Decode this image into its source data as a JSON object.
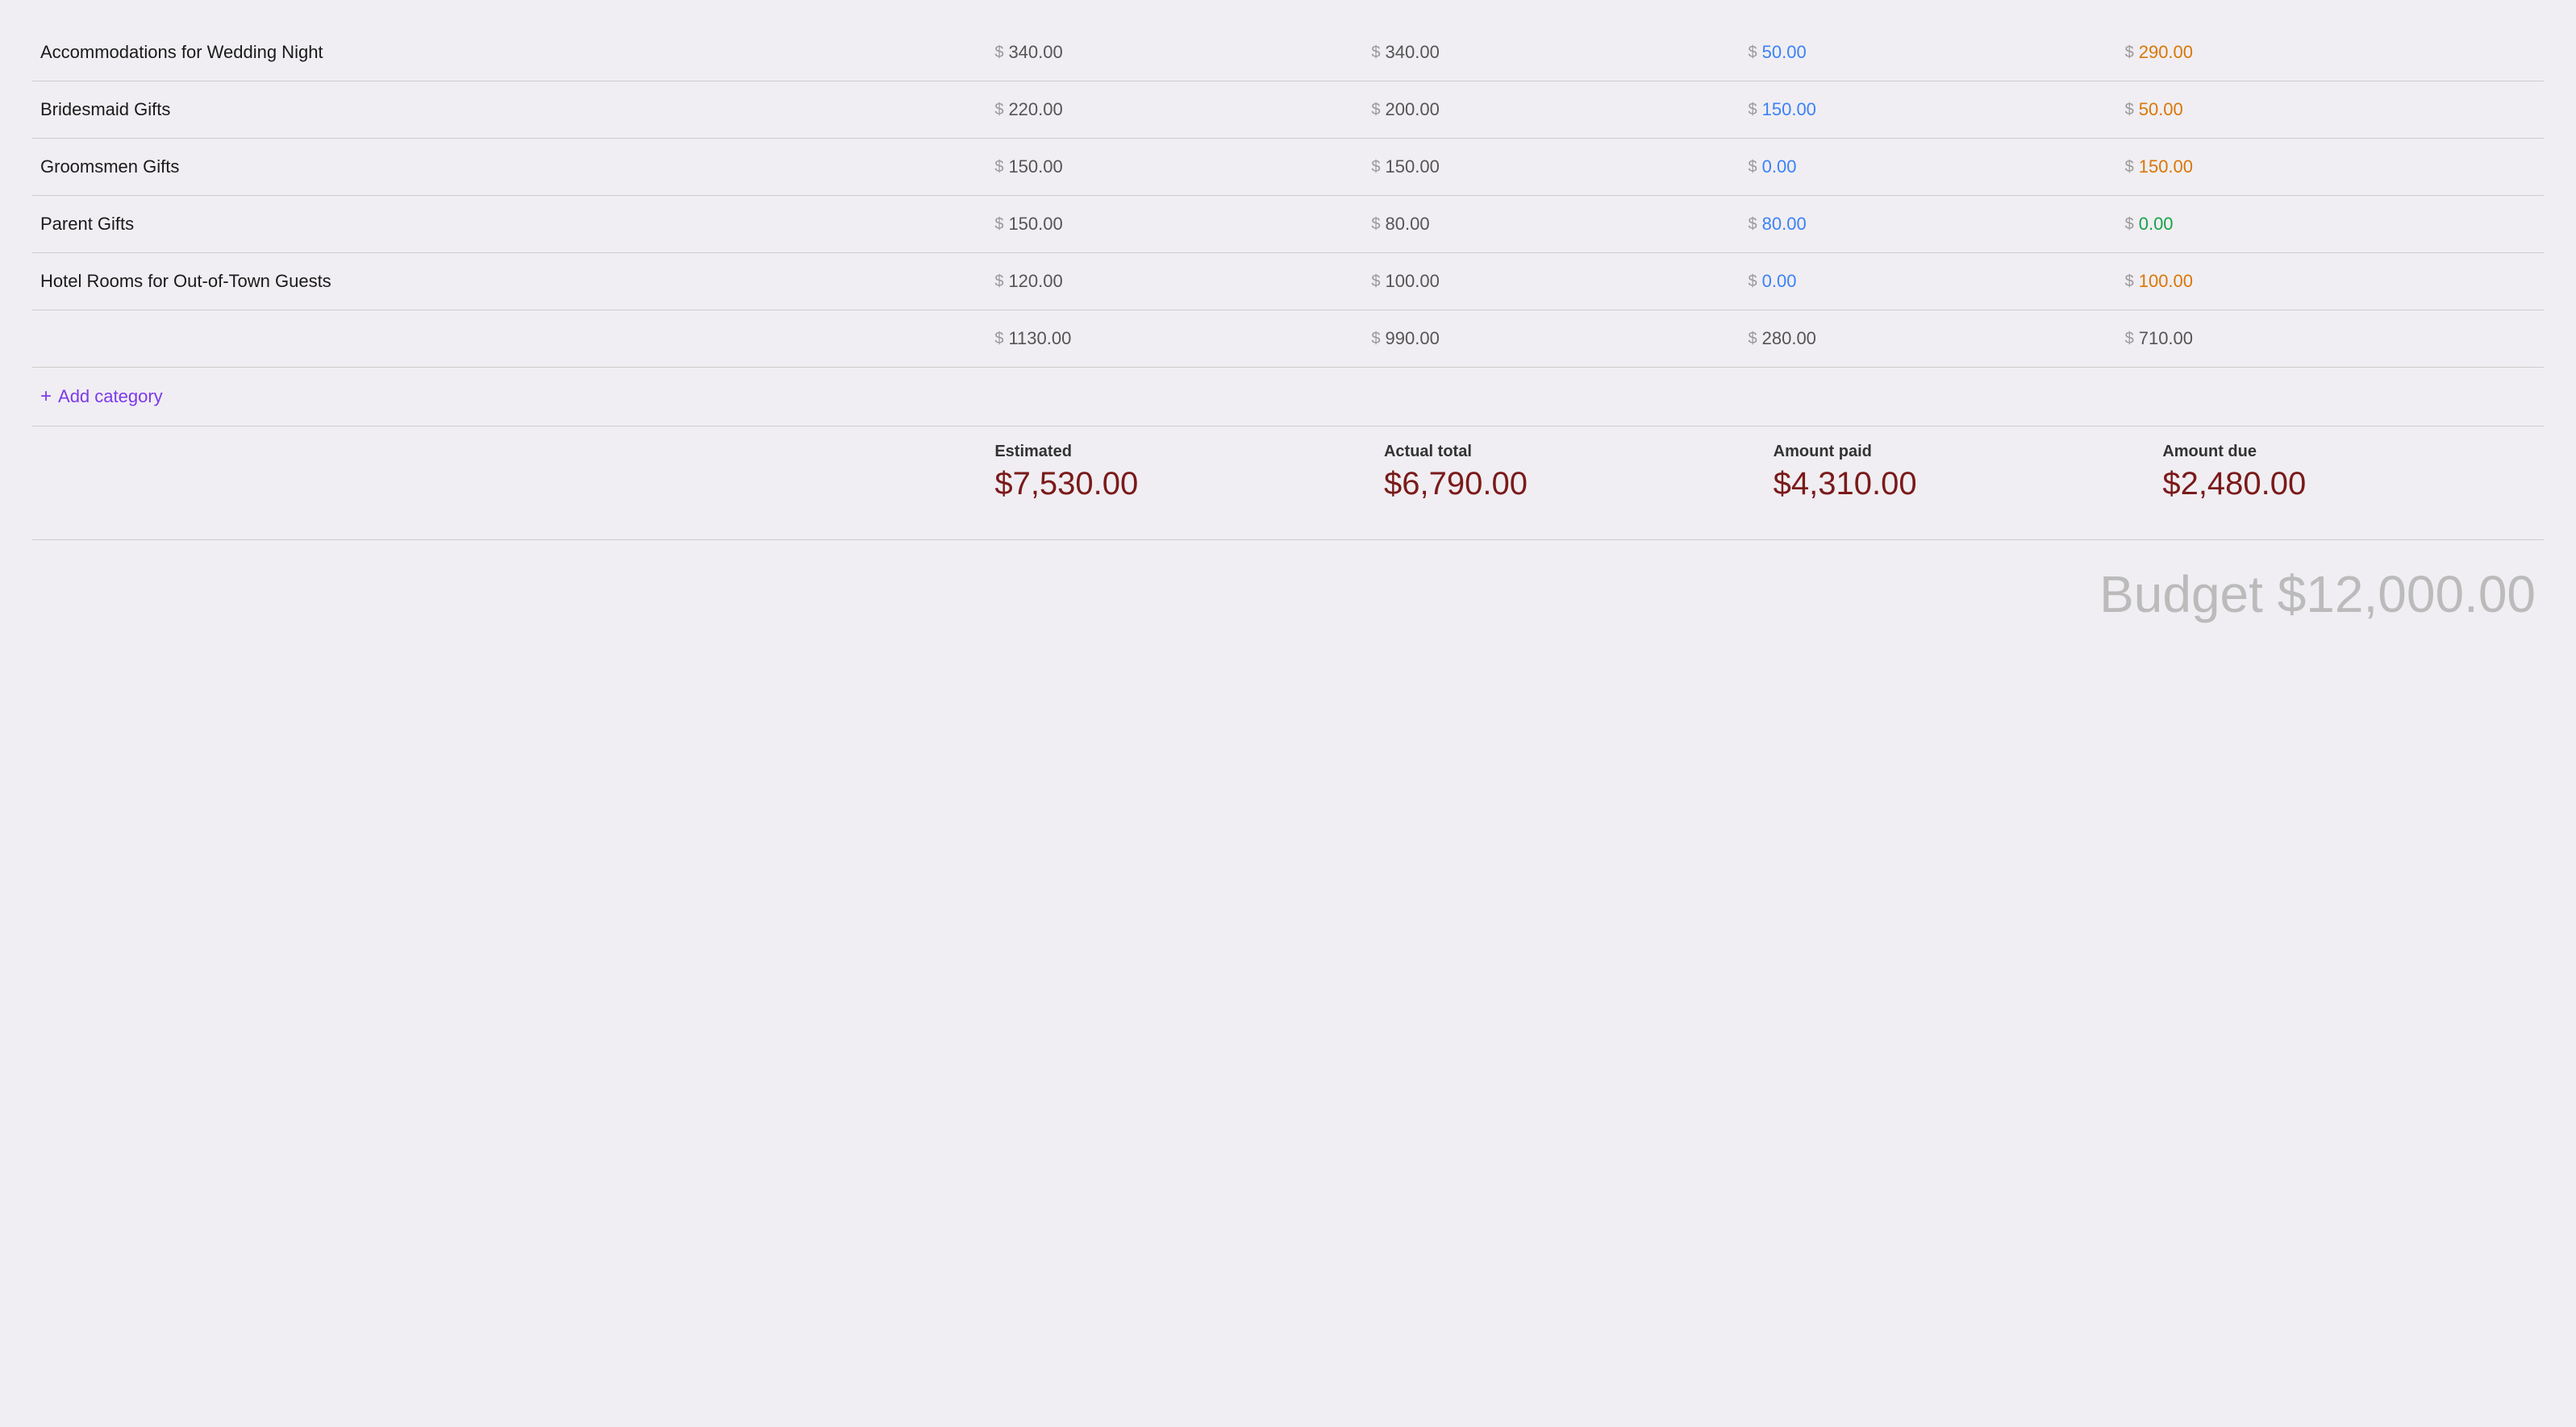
{
  "rows": [
    {
      "name": "Accommodations for Wedding Night",
      "estimated": "340.00",
      "actual": "340.00",
      "paid": "50.00",
      "due": "290.00",
      "paid_color": "blue",
      "due_color": "orange"
    },
    {
      "name": "Bridesmaid Gifts",
      "estimated": "220.00",
      "actual": "200.00",
      "paid": "150.00",
      "due": "50.00",
      "paid_color": "blue",
      "due_color": "orange"
    },
    {
      "name": "Groomsmen Gifts",
      "estimated": "150.00",
      "actual": "150.00",
      "paid": "0.00",
      "due": "150.00",
      "paid_color": "blue",
      "due_color": "orange"
    },
    {
      "name": "Parent Gifts",
      "estimated": "150.00",
      "actual": "80.00",
      "paid": "80.00",
      "due": "0.00",
      "paid_color": "blue",
      "due_color": "green"
    },
    {
      "name": "Hotel Rooms for Out-of-Town Guests",
      "estimated": "120.00",
      "actual": "100.00",
      "paid": "0.00",
      "due": "100.00",
      "paid_color": "blue",
      "due_color": "orange"
    }
  ],
  "totals": {
    "estimated": "1130.00",
    "actual": "990.00",
    "paid": "280.00",
    "due": "710.00"
  },
  "add_category_label": "Add category",
  "summary": {
    "estimated_label": "Estimated",
    "estimated_value": "$7,530.00",
    "actual_label": "Actual total",
    "actual_value": "$6,790.00",
    "paid_label": "Amount paid",
    "paid_value": "$4,310.00",
    "due_label": "Amount due",
    "due_value": "$2,480.00"
  },
  "budget_label": "Budget $12,000.00",
  "dollar_sign": "$"
}
